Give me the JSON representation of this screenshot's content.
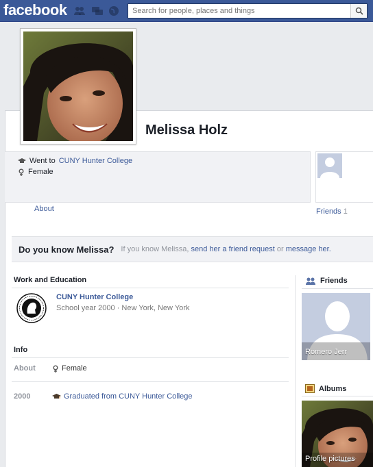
{
  "header": {
    "logo": "facebook",
    "search_placeholder": "Search for people, places and things"
  },
  "profile": {
    "name": "Melissa Holz",
    "went_to_prefix": "Went to",
    "school_link": "CUNY Hunter College",
    "gender": "Female"
  },
  "tabs": {
    "about": "About",
    "friends": "Friends",
    "friends_count": "1"
  },
  "know_banner": {
    "title": "Do you know Melissa?",
    "text_prefix": "If you know Melissa,",
    "friend_request_link": "send her a friend request",
    "or": "or",
    "message_link": "message her."
  },
  "work_education": {
    "title": "Work and Education",
    "school": "CUNY Hunter College",
    "detail": "School year 2000 · New York, New York"
  },
  "info": {
    "title": "Info",
    "about_label": "About",
    "gender": "Female",
    "year_label": "2000",
    "graduated_text": "Graduated from CUNY Hunter College"
  },
  "sidebar": {
    "friends_title": "Friends",
    "friend_name": "Romero Jerr",
    "albums_title": "Albums",
    "album_name": "Profile pictures"
  },
  "colors": {
    "brand_blue": "#3b5998",
    "link": "#3b5998",
    "panel_gray": "#f1f2f5"
  }
}
